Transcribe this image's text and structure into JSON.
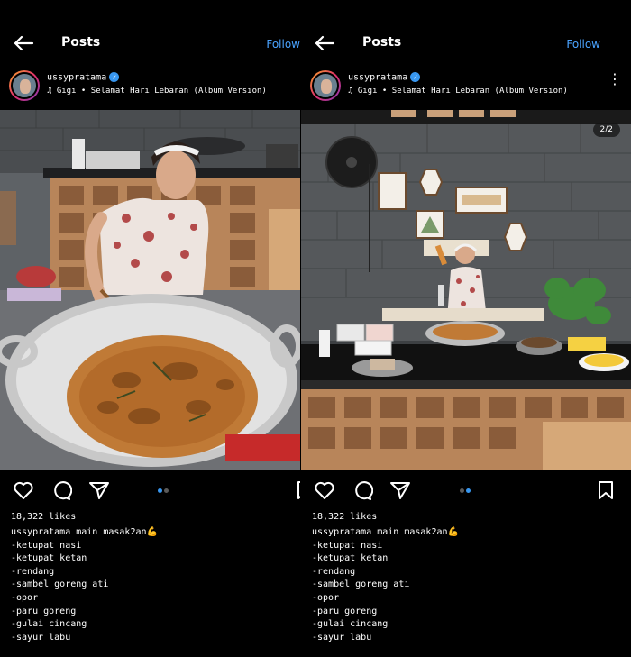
{
  "nav": {
    "title": "Posts",
    "follow_label": "Follow"
  },
  "post": {
    "username": "ussypratama",
    "music": "Gigi • Selamat Hari Lebaran (Album Version)",
    "likes": "18,322 likes",
    "caption_head": "ussypratama main masak2an💪",
    "caption_lines": [
      "-ketupat nasi",
      "-ketupat ketan",
      "-rendang",
      "-sambel goreng ati",
      "-opor",
      "-paru goreng",
      "-gulai cincang",
      "-sayur labu"
    ],
    "slide_counter": "2/2"
  },
  "colors": {
    "accent": "#4aa3ff",
    "background": "#000000",
    "active_dot": "#3897f0"
  }
}
